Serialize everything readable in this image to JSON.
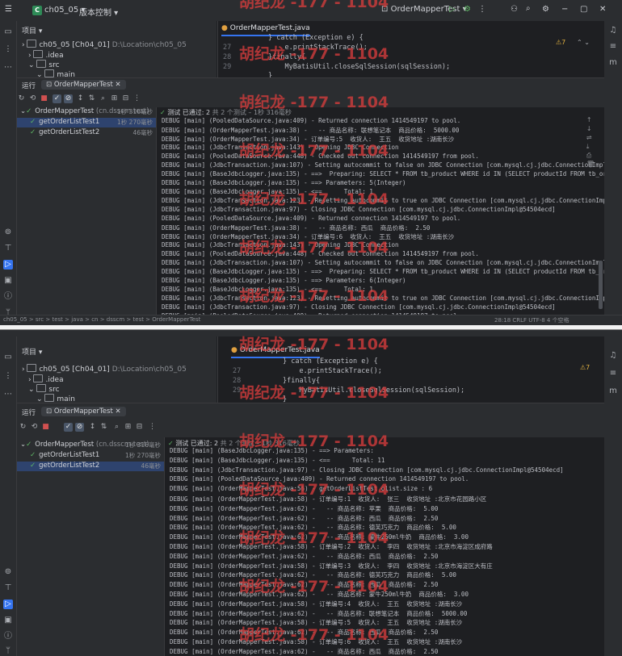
{
  "watermark": "胡纪龙 -177 - 1104",
  "window1": {
    "titlebar": {
      "project_badge": "C",
      "project_name": "ch05_05",
      "vcs": "版本控制",
      "run_config": "OrderMapperTest",
      "window_controls": [
        "−",
        "▢",
        "✕"
      ]
    },
    "project_panel": {
      "title": "项目",
      "rows": [
        {
          "name": "ch05_05 [Ch04_01]",
          "path": "D:\\Location\\ch05_05"
        },
        {
          "name": ".idea",
          "path": ""
        },
        {
          "name": "src",
          "path": ""
        },
        {
          "name": "main",
          "path": ""
        }
      ]
    },
    "editor": {
      "tab": "OrderMapperTest.java",
      "warning_count": "⚠7",
      "lines": [
        {
          "n": "",
          "code": "} catch (Exception e) {"
        },
        {
          "n": "27",
          "code": "    e.printStackTrace();"
        },
        {
          "n": "28",
          "code": "}finally{"
        },
        {
          "n": "29",
          "code": "    MyBatisUtil.closeSqlSession(sqlSession);"
        },
        {
          "n": "",
          "code": "}"
        }
      ]
    },
    "run": {
      "label": "运行",
      "tab": "OrderMapperTest",
      "tree": [
        {
          "name": "OrderMapperTest",
          "suffix": "(cn.dsscm.test)",
          "time": "1秒 316毫秒",
          "selected": false,
          "indent": 1
        },
        {
          "name": "getOrderListTest1",
          "suffix": "",
          "time": "1秒 270毫秒",
          "selected": true,
          "indent": 2
        },
        {
          "name": "getOrderListTest2",
          "suffix": "",
          "time": "46毫秒",
          "selected": false,
          "indent": 2
        }
      ],
      "status": {
        "passed": "测试 已通过: 2",
        "total": "共 2 个测试",
        "time": "– 1秒 316毫秒"
      },
      "logs": [
        "DEBUG [main] (PooledDataSource.java:409) - Returned connection 1414549197 to pool.",
        "DEBUG [main] (OrderMapperTest.java:38) -   -- 商品名称: 联想笔记本  商品价格:  5000.00",
        "DEBUG [main] (OrderMapperTest.java:34) - 订单编号:5  收货人:  王五  收货地址 :湖南长沙",
        "DEBUG [main] (JdbcTransaction.java:143) - Opening JDBC Connection",
        "DEBUG [main] (PooledDataSource.java:448) - Checked out connection 1414549197 from pool.",
        "DEBUG [main] (JdbcTransaction.java:107) - Setting autocommit to false on JDBC Connection [com.mysql.cj.jdbc.ConnectionImpl@54504ecd]",
        "DEBUG [main] (BaseJdbcLogger.java:135) - ==>  Preparing: SELECT * FROM tb_product WHERE id IN (SELECT productId FROM tb_order_detail",
        "DEBUG [main] (BaseJdbcLogger.java:135) - ==> Parameters: 5(Integer)",
        "DEBUG [main] (BaseJdbcLogger.java:135) - <==      Total: 1",
        "DEBUG [main] (JdbcTransaction.java:123) - Resetting autocommit to true on JDBC Connection [com.mysql.cj.jdbc.ConnectionImpl@54504ecd",
        "DEBUG [main] (JdbcTransaction.java:97) - Closing JDBC Connection [com.mysql.cj.jdbc.ConnectionImpl@54504ecd]",
        "DEBUG [main] (PooledDataSource.java:409) - Returned connection 1414549197 to pool.",
        "DEBUG [main] (OrderMapperTest.java:38) -   -- 商品名称: 西瓜  商品价格:  2.50",
        "DEBUG [main] (OrderMapperTest.java:34) - 订单编号:6  收货人:  王五  收货地址 :湖南长沙",
        "DEBUG [main] (JdbcTransaction.java:143) - Opening JDBC Connection",
        "DEBUG [main] (PooledDataSource.java:448) - Checked out connection 1414549197 from pool.",
        "DEBUG [main] (JdbcTransaction.java:107) - Setting autocommit to false on JDBC Connection [com.mysql.cj.jdbc.ConnectionImpl@54504ecd]",
        "DEBUG [main] (BaseJdbcLogger.java:135) - ==>  Preparing: SELECT * FROM tb_product WHERE id IN (SELECT productId FROM tb_order_detail",
        "DEBUG [main] (BaseJdbcLogger.java:135) - ==> Parameters: 6(Integer)",
        "DEBUG [main] (BaseJdbcLogger.java:135) - <==      Total: 1",
        "DEBUG [main] (JdbcTransaction.java:123) - Resetting autocommit to true on JDBC Connection [com.mysql.cj.jdbc.ConnectionImpl@54504ecd",
        "DEBUG [main] (JdbcTransaction.java:97) - Closing JDBC Connection [com.mysql.cj.jdbc.ConnectionImpl@54504ecd]",
        "DEBUG [main] (PooledDataSource.java:409) - Returned connection 1414549197 to pool."
      ]
    },
    "statusbar": {
      "breadcrumb": "ch05_05 > src > test > java > cn > dsscm > test > OrderMapperTest",
      "right": "28:18   CRLF   UTF-8   4 个空格"
    }
  },
  "window2": {
    "project_panel": {
      "title": "项目",
      "rows": [
        {
          "name": "ch05_05 [Ch04_01]",
          "path": "D:\\Location\\ch05_05"
        },
        {
          "name": ".idea",
          "path": ""
        },
        {
          "name": "src",
          "path": ""
        },
        {
          "name": "main",
          "path": ""
        }
      ]
    },
    "editor": {
      "tab": "OrderMapperTest.java",
      "warning_count": "⚠7",
      "lines": [
        {
          "n": "",
          "code": "} catch (Exception e) {"
        },
        {
          "n": "27",
          "code": "    e.printStackTrace();"
        },
        {
          "n": "28",
          "code": "}finally{"
        },
        {
          "n": "29",
          "code": "    MyBatisUtil.closeSqlSession(sqlSession);"
        },
        {
          "n": "",
          "code": "}"
        }
      ]
    },
    "run": {
      "label": "运行",
      "tab": "OrderMapperTest",
      "tree": [
        {
          "name": "OrderMapperTest",
          "suffix": "(cn.dsscm.test)",
          "time": "1秒 316毫秒",
          "selected": false,
          "indent": 1
        },
        {
          "name": "getOrderListTest1",
          "suffix": "",
          "time": "1秒 270毫秒",
          "selected": false,
          "indent": 2
        },
        {
          "name": "getOrderListTest2",
          "suffix": "",
          "time": "46毫秒",
          "selected": true,
          "indent": 2
        }
      ],
      "status": {
        "passed": "测试 已通过: 2",
        "total": "共 2 个测试",
        "time": "– 1秒 316毫秒"
      },
      "logs": [
        "DEBUG [main] (BaseJdbcLogger.java:135) - ==> Parameters:",
        "DEBUG [main] (BaseJdbcLogger.java:135) - <==      Total: 11",
        "DEBUG [main] (JdbcTransaction.java:97) - Closing JDBC Connection [com.mysql.cj.jdbc.ConnectionImpl@54504ecd]",
        "DEBUG [main] (PooledDataSource.java:409) - Returned connection 1414549197 to pool.",
        "DEBUG [main] (OrderMapperTest.java:56) - getOrderListTest olist.size : 6",
        "DEBUG [main] (OrderMapperTest.java:58) - 订单编号:1  收货人:  张三  收货地址 :北京市花园路小区",
        "DEBUG [main] (OrderMapperTest.java:62) -   -- 商品名称: 苹果  商品价格:  5.00",
        "DEBUG [main] (OrderMapperTest.java:62) -   -- 商品名称: 西瓜  商品价格:  2.50",
        "DEBUG [main] (OrderMapperTest.java:62) -   -- 商品名称: 德芙巧克力  商品价格:  5.00",
        "DEBUG [main] (OrderMapperTest.java:62) -   -- 商品名称: 蒙牛250ml牛奶  商品价格:  3.00",
        "DEBUG [main] (OrderMapperTest.java:58) - 订单编号:2  收货人:  李四  收货地址 :北京市海淀区成府路",
        "DEBUG [main] (OrderMapperTest.java:62) -   -- 商品名称: 西瓜  商品价格:  2.50",
        "DEBUG [main] (OrderMapperTest.java:58) - 订单编号:3  收货人:  李四  收货地址 :北京市海淀区大有庄",
        "DEBUG [main] (OrderMapperTest.java:62) -   -- 商品名称: 德芙巧克力  商品价格:  5.00",
        "DEBUG [main] (OrderMapperTest.java:62) -   -- 商品名称: 西瓜  商品价格:  2.50",
        "DEBUG [main] (OrderMapperTest.java:62) -   -- 商品名称: 蒙牛250ml牛奶  商品价格:  3.00",
        "DEBUG [main] (OrderMapperTest.java:58) - 订单编号:4  收货人:  王五  收货地址 :湖南长沙",
        "DEBUG [main] (OrderMapperTest.java:62) -   -- 商品名称: 联想笔记本  商品价格:  5000.00",
        "DEBUG [main] (OrderMapperTest.java:58) - 订单编号:5  收货人:  王五  收货地址 :湖南长沙",
        "DEBUG [main] (OrderMapperTest.java:62) -   -- 商品名称: 西瓜  商品价格:  2.50",
        "DEBUG [main] (OrderMapperTest.java:58) - 订单编号:6  收货人:  王五  收货地址 :湖南长沙",
        "DEBUG [main] (OrderMapperTest.java:62) -   -- 商品名称: 西瓜  商品价格:  2.50"
      ]
    }
  }
}
